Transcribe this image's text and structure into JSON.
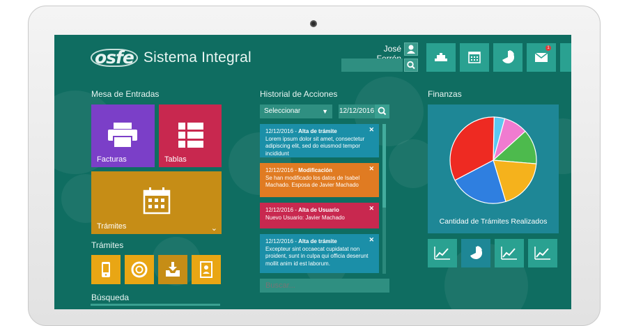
{
  "app": {
    "logo": "osfe",
    "title": "Sistema Integral"
  },
  "user": {
    "name": "José Ferrón"
  },
  "header": {
    "tiles": [
      {
        "icon": "home-icon"
      },
      {
        "icon": "calendar-icon"
      },
      {
        "icon": "pie-chart-icon"
      },
      {
        "icon": "mail-icon",
        "badge": "1"
      }
    ]
  },
  "mesa": {
    "title": "Mesa de Entradas",
    "tiles": [
      {
        "label": "Facturas",
        "icon": "printer-icon",
        "color": "#7b3fc8"
      },
      {
        "label": "Tablas",
        "icon": "list-icon",
        "color": "#c8284f"
      },
      {
        "label": "Trámites",
        "icon": "calendar-icon",
        "color": "#c68d16"
      }
    ]
  },
  "tramites": {
    "title": "Trámites",
    "tiles": [
      {
        "icon": "mobile-icon"
      },
      {
        "icon": "lifebuoy-icon"
      },
      {
        "icon": "inbox-download-icon"
      },
      {
        "icon": "contacts-icon"
      }
    ]
  },
  "busqueda": {
    "title": "Búsqueda"
  },
  "historial": {
    "title": "Historial de Acciones",
    "select_value": "Seleccionar",
    "date_value": "12/12/2016",
    "search_placeholder": "Buscar...",
    "cards": [
      {
        "date": "12/12/2016 - ",
        "type": "Alta de trámite",
        "text": "Lorem ipsum dolor sit amet, consectetur adipiscing elit, sed do eiusmod tempor incididunt",
        "color": "#1b8fa8"
      },
      {
        "date": "12/12/2016 - ",
        "type": "Modificación",
        "text": "Se han modificado los datos de Isabel Machado. Esposa de Javier Machado",
        "color": "#e07b22"
      },
      {
        "date": "12/12/2016 - ",
        "type": "Alta de Usuario",
        "text": "Nuevo Usuario: Javier Machado",
        "color": "#c8284f"
      },
      {
        "date": "12/12/2016 - ",
        "type": "Alta de trámite",
        "text": "Excepteur sint occaecat cupidatat non proident, sunt in culpa qui officia deserunt mollit anim id est laborum.",
        "color": "#1b8fa8"
      }
    ]
  },
  "finanzas": {
    "title": "Finanzas",
    "chart_caption": "Cantidad de Trámites Realizados",
    "tiles": [
      {
        "icon": "line-chart-icon"
      },
      {
        "icon": "pie-chart-icon"
      },
      {
        "icon": "line-chart-icon"
      },
      {
        "icon": "line-chart-icon"
      }
    ]
  },
  "chart_data": {
    "type": "pie",
    "title": "Cantidad de Trámites Realizados",
    "slices": [
      {
        "value": 4,
        "color": "#5bc8f0"
      },
      {
        "value": 9,
        "color": "#f07bd0"
      },
      {
        "value": 13,
        "color": "#4dba4d"
      },
      {
        "value": 19,
        "color": "#f5b21c"
      },
      {
        "value": 22,
        "color": "#2f7fe0"
      },
      {
        "value": 33,
        "color": "#ee2a22"
      }
    ]
  }
}
